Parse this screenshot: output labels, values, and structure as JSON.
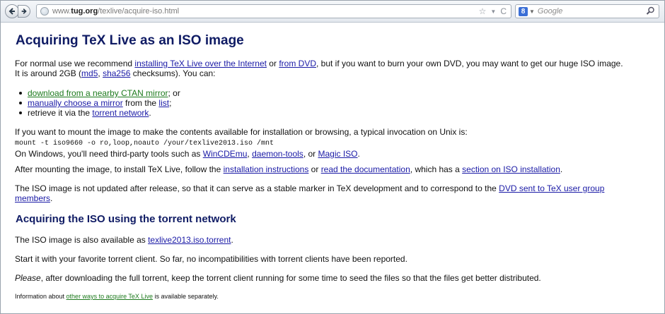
{
  "browser": {
    "url_prefix": "www.",
    "url_host": "tug.org",
    "url_path": "/texlive/acquire-iso.html",
    "search_engine_letter": "8",
    "search_placeholder": "Google"
  },
  "page": {
    "title": "Acquiring TeX Live as an ISO image",
    "intro": {
      "t1": "For normal use we recommend ",
      "l1": "installing TeX Live over the Internet",
      "t2": " or ",
      "l2": "from DVD",
      "t3": ", but if you want to burn your own DVD, you may want to get our huge ISO image.",
      "t4": "It is around 2GB (",
      "l3": "md5",
      "t5": ", ",
      "l4": "sha256",
      "t6": " checksums). You can:"
    },
    "options": {
      "o1_link": "download from a nearby CTAN mirror",
      "o1_text": "; or",
      "o2_link": "manually choose a mirror",
      "o2_text": " from the ",
      "o2_link2": "list",
      "o2_text2": ";",
      "o3_text": "retrieve it via the ",
      "o3_link": "torrent network",
      "o3_text2": "."
    },
    "mount": {
      "text": "If you want to mount the image to make the contents available for installation or browsing, a typical invocation on Unix is:",
      "command": "mount -t iso9660 -o ro,loop,noauto /your/texlive2013.iso /mnt",
      "win_t1": "On Windows, you'll need third-party tools such as ",
      "win_l1": "WinCDEmu",
      "win_t2": ", ",
      "win_l2": "daemon-tools",
      "win_t3": ", or ",
      "win_l3": "Magic ISO",
      "win_t4": "."
    },
    "after": {
      "t1": "After mounting the image, to install TeX Live, follow the ",
      "l1": "installation instructions",
      "t2": " or ",
      "l2": "read the documentation",
      "t3": ", which has a ",
      "l3": "section on ISO installation",
      "t4": "."
    },
    "notupdated": {
      "t1": "The ISO image is not updated after release, so that it can serve as a stable marker in TeX development and to correspond to the ",
      "l1a": "DVD sent to TeX user group",
      "l1b": "members",
      "t2": "."
    },
    "torrent_heading": "Acquiring the ISO using the torrent network",
    "torrent1": {
      "t1": "The ISO image is also available as ",
      "l1": "texlive2013.iso.torrent",
      "t2": "."
    },
    "torrent2": "Start it with your favorite torrent client. So far, no incompatibilities with torrent clients have been reported.",
    "torrent3": {
      "em": "Please",
      "t1": ", after downloading the full torrent, keep the torrent client running for some time to seed the files so that the files get better distributed."
    },
    "footer": {
      "t1": "Information about ",
      "l1": "other ways to acquire TeX Live",
      "t2": " is available separately."
    }
  }
}
